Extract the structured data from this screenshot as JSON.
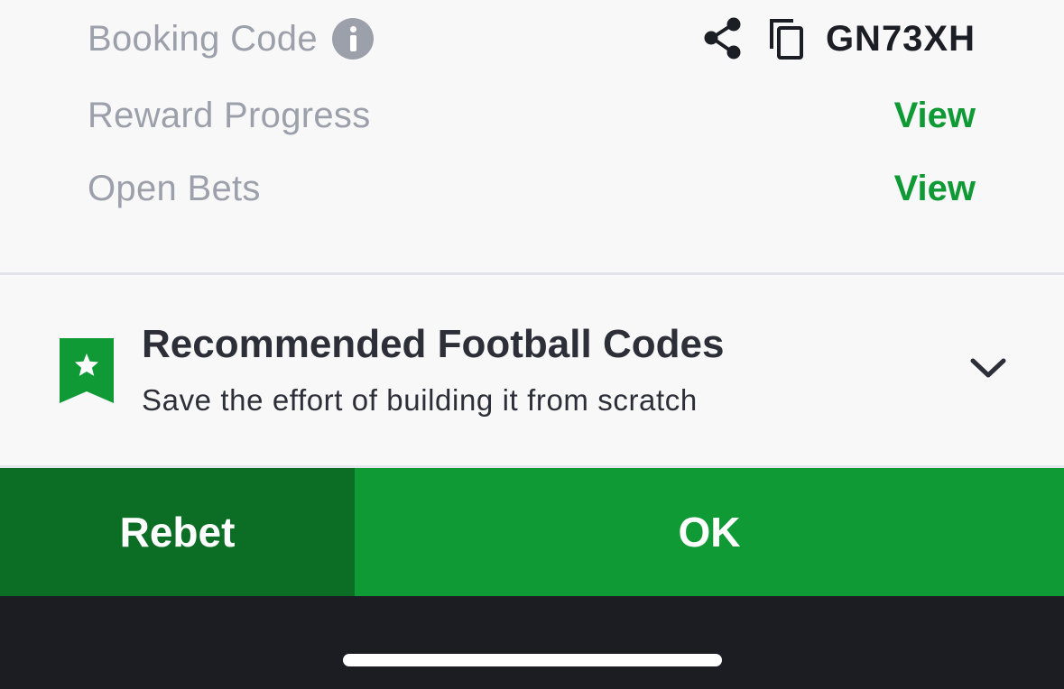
{
  "booking": {
    "label": "Booking Code",
    "code": "GN73XH"
  },
  "reward_progress": {
    "label": "Reward Progress",
    "action": "View"
  },
  "open_bets": {
    "label": "Open Bets",
    "action": "View"
  },
  "recommended": {
    "title": "Recommended Football Codes",
    "subtitle": "Save the effort of building it from scratch"
  },
  "actions": {
    "rebet_label": "Rebet",
    "ok_label": "OK"
  },
  "colors": {
    "accent_green": "#0f9a36",
    "dark_green": "#0c6e25",
    "muted_text": "#9ca0ab"
  },
  "icons": {
    "info": "info-icon",
    "share": "share-icon",
    "copy": "copy-icon",
    "bookmark": "bookmark-star-icon",
    "chevron": "chevron-down-icon"
  }
}
